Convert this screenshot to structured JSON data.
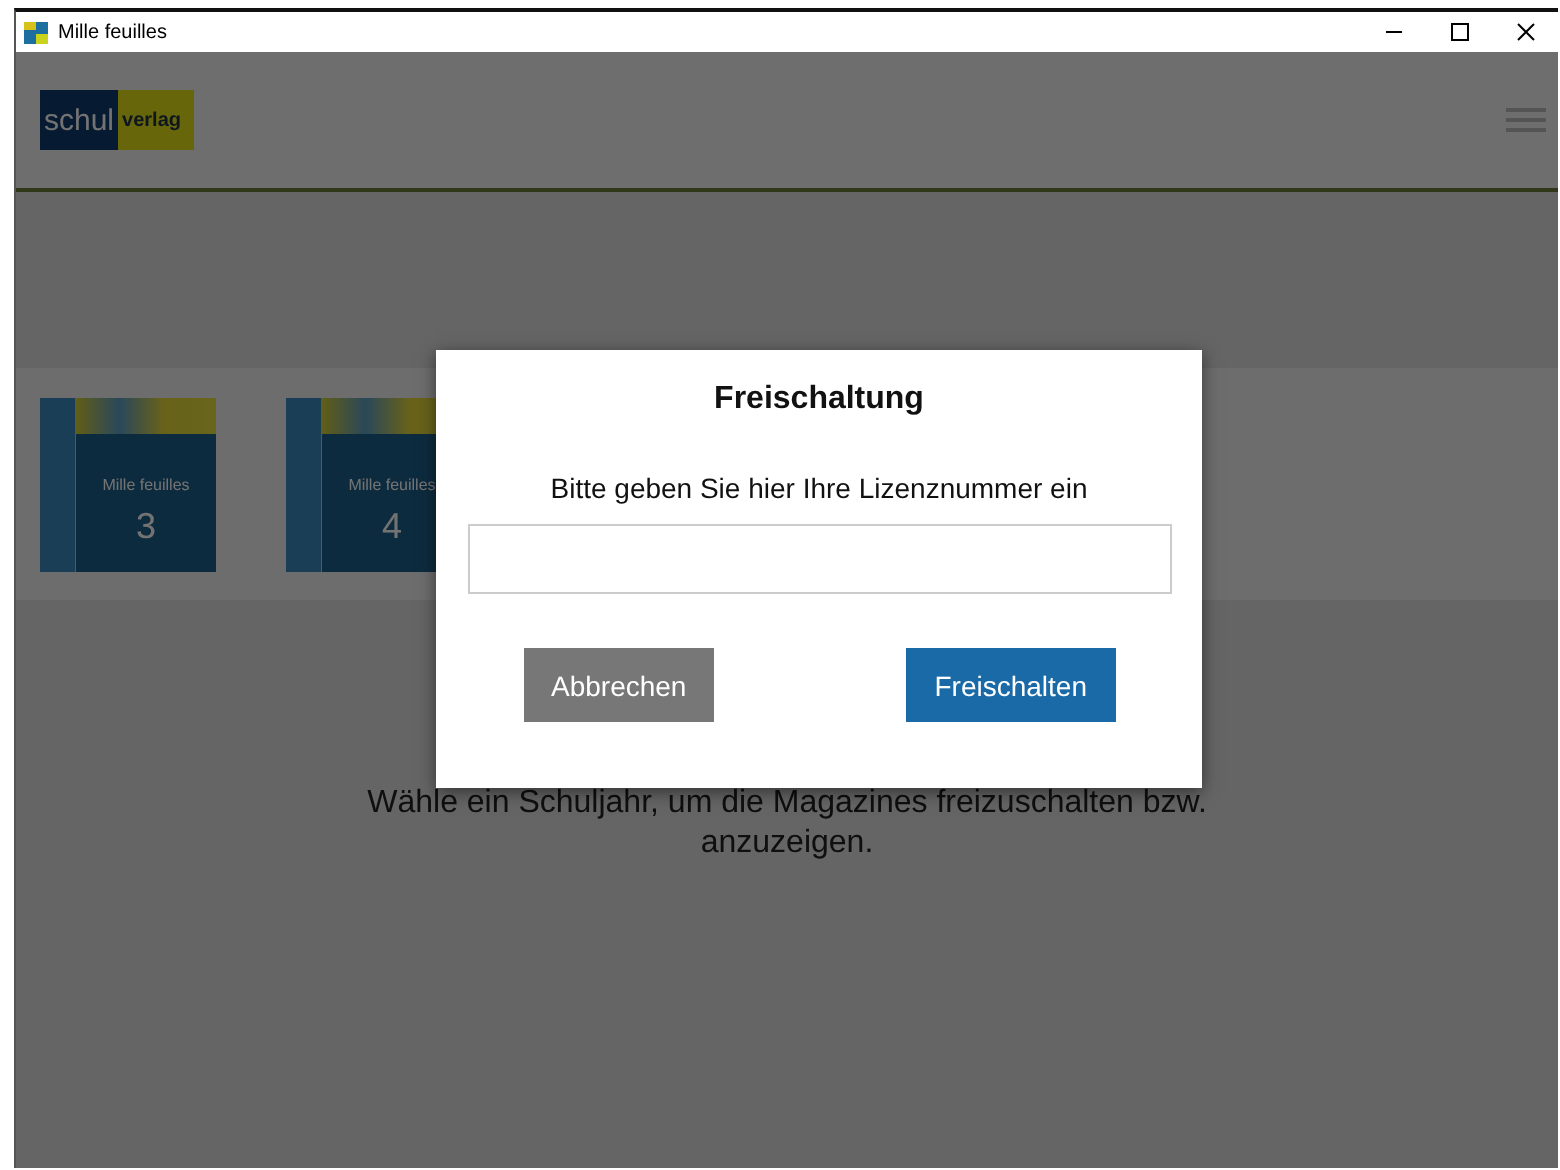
{
  "window": {
    "title": "Mille feuilles"
  },
  "header": {
    "logo_left": "schul",
    "logo_right": "verlag"
  },
  "tiles": [
    {
      "title": "Mille feuilles",
      "number": "3"
    },
    {
      "title": "Mille feuilles",
      "number": "4"
    }
  ],
  "message": "Wähle ein Schuljahr, um die Magazines freizuschalten bzw. anzuzeigen.",
  "dialog": {
    "title": "Freischaltung",
    "prompt": "Bitte geben Sie hier Ihre Lizenznummer ein",
    "buttons": [
      {
        "label": "Abbrechen",
        "kind": "secondary"
      },
      {
        "label": "Freischalten",
        "kind": "primary"
      }
    ]
  }
}
